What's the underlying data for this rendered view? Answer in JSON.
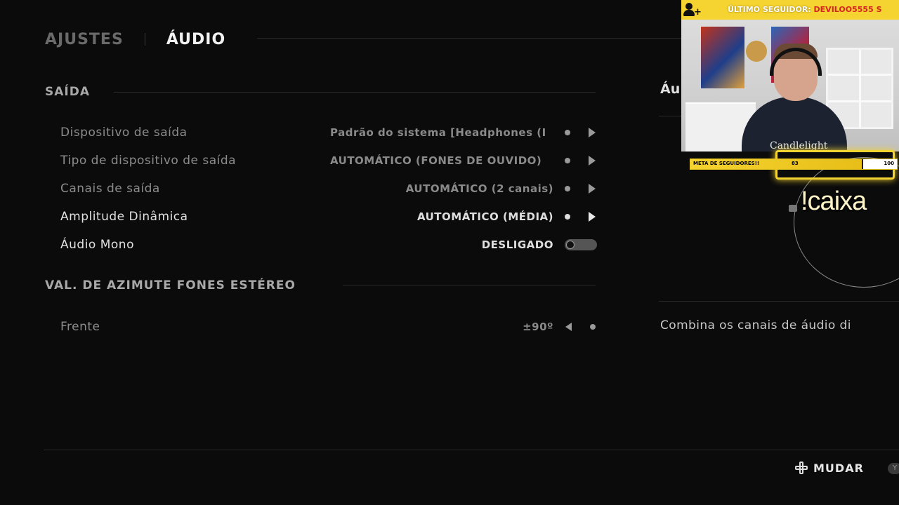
{
  "tabs": [
    {
      "label": "AJUSTES",
      "active": false
    },
    {
      "label": "ÁUDIO",
      "active": true
    }
  ],
  "sections": {
    "output": {
      "title": "SAÍDA",
      "rows": [
        {
          "label": "Dispositivo de saída",
          "value": "Padrão do sistema [Headphones (I"
        },
        {
          "label": "Tipo de dispositivo de saída",
          "value": "AUTOMÁTICO (FONES DE OUVIDO)"
        },
        {
          "label": "Canais de saída",
          "value": "AUTOMÁTICO (2 canais)"
        },
        {
          "label": "Amplitude Dinâmica",
          "value": "AUTOMÁTICO (MÉDIA)"
        },
        {
          "label": "Áudio Mono",
          "value": "DESLIGADO",
          "toggle_on": false
        }
      ]
    },
    "azimuth": {
      "title": "VAL. DE AZIMUTE FONES ESTÉREO",
      "rows": [
        {
          "label": "Frente",
          "value": "±90º"
        }
      ]
    }
  },
  "info_panel": {
    "title": "Áu",
    "description": "Combina os canais de áudio di"
  },
  "footer": {
    "action_label": "MUDAR",
    "secondary_button": "Y"
  },
  "stream_overlay": {
    "last_follower_label": "ÚLTIMO SEGUIDOR:",
    "last_follower_name": "DEVILOO5555",
    "last_follower_suffix": "S",
    "goal_label": "META DE SEGUIDORES!!",
    "goal_current": "83",
    "goal_max": "100",
    "goal_progress": 0.83,
    "shirt_text": "Candlelight",
    "command": "!caixa",
    "accent_color": "#f5d330"
  }
}
